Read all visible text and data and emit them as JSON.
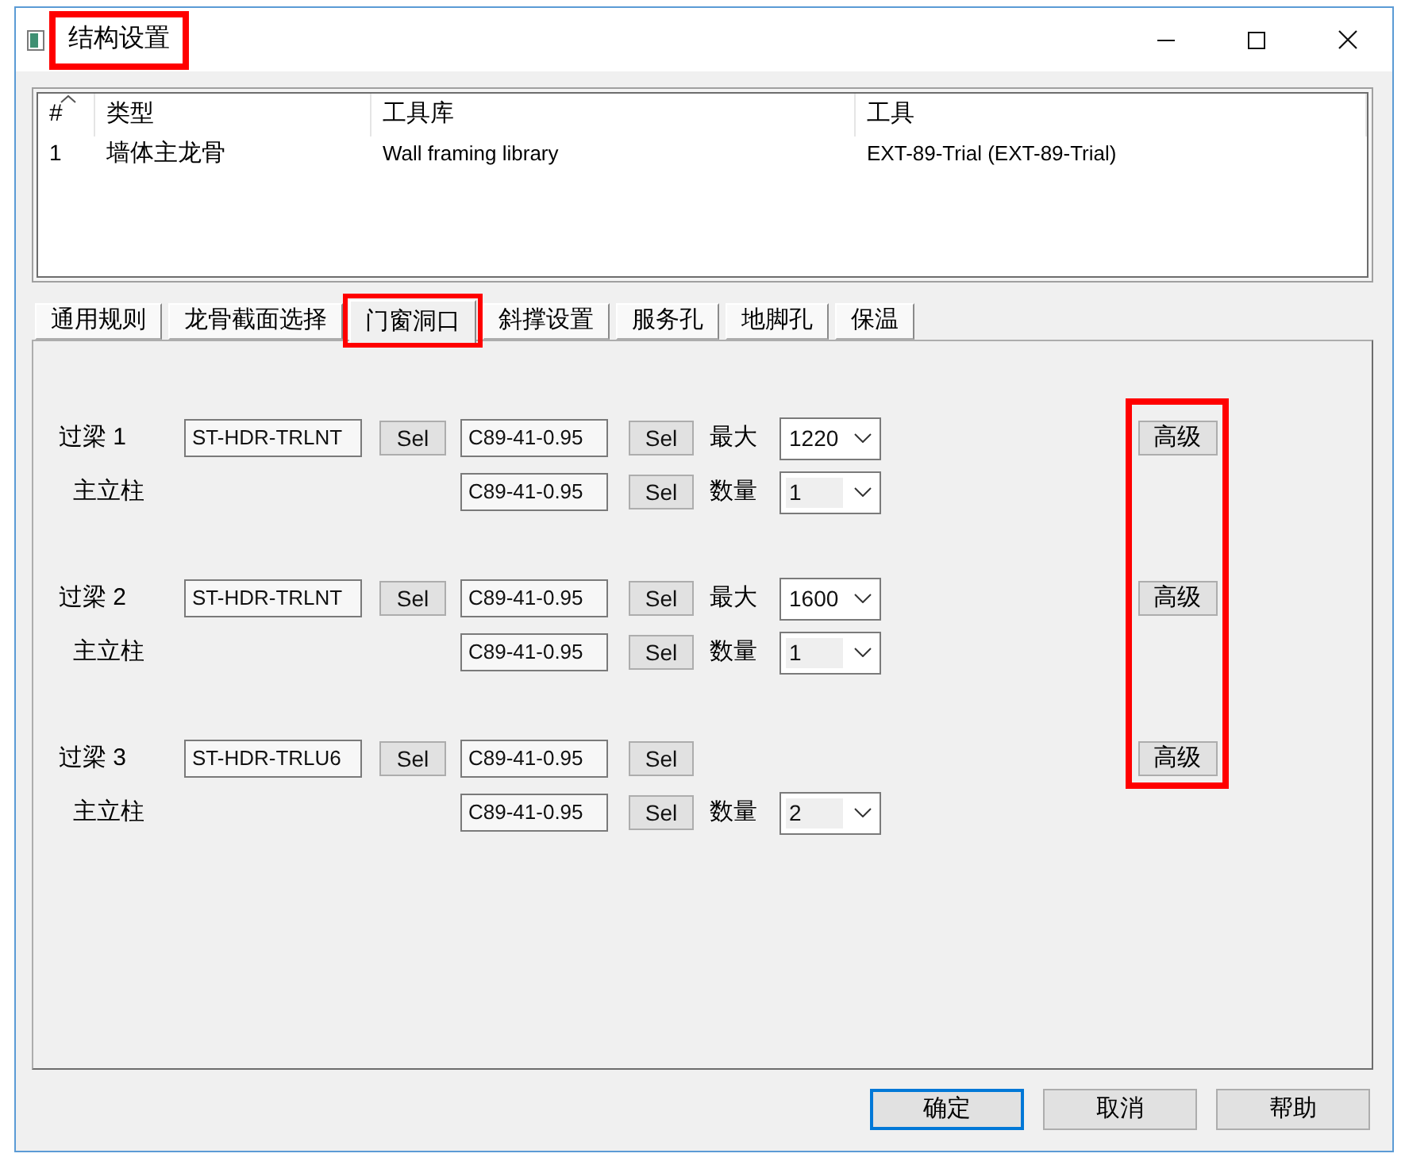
{
  "window": {
    "title": "结构设置",
    "title_highlighted": true
  },
  "list": {
    "columns": [
      "#",
      "类型",
      "工具库",
      "工具"
    ],
    "rows": [
      [
        "1",
        "墙体主龙骨",
        "Wall framing library",
        "EXT-89-Trial (EXT-89-Trial)"
      ]
    ]
  },
  "tabs": [
    {
      "label": "通用规则",
      "selected": false,
      "highlighted": false
    },
    {
      "label": "龙骨截面选择",
      "selected": false,
      "highlighted": false
    },
    {
      "label": "门窗洞口",
      "selected": true,
      "highlighted": true
    },
    {
      "label": "斜撑设置",
      "selected": false,
      "highlighted": false
    },
    {
      "label": "服务孔",
      "selected": false,
      "highlighted": false
    },
    {
      "label": "地脚孔",
      "selected": false,
      "highlighted": false
    },
    {
      "label": "保温",
      "selected": false,
      "highlighted": false
    }
  ],
  "panel": {
    "advanced_highlighted": true,
    "groups": [
      {
        "header": {
          "label": "过梁 1",
          "section": "ST-HDR-TRLNT",
          "section_button": "Sel",
          "stud": "C89-41-0.95",
          "stud_button": "Sel",
          "limit_label": "最大",
          "limit_value": "1220"
        },
        "stud_row": {
          "label": "主立柱",
          "stud": "C89-41-0.95",
          "stud_button": "Sel",
          "count_label": "数量",
          "count_value": "1"
        },
        "advanced_button": "高级"
      },
      {
        "header": {
          "label": "过梁 2",
          "section": "ST-HDR-TRLNT",
          "section_button": "Sel",
          "stud": "C89-41-0.95",
          "stud_button": "Sel",
          "limit_label": "最大",
          "limit_value": "1600"
        },
        "stud_row": {
          "label": "主立柱",
          "stud": "C89-41-0.95",
          "stud_button": "Sel",
          "count_label": "数量",
          "count_value": "1"
        },
        "advanced_button": "高级"
      },
      {
        "header": {
          "label": "过梁 3",
          "section": "ST-HDR-TRLU6",
          "section_button": "Sel",
          "stud": "C89-41-0.95",
          "stud_button": "Sel"
        },
        "stud_row": {
          "label": "主立柱",
          "stud": "C89-41-0.95",
          "stud_button": "Sel",
          "count_label": "数量",
          "count_value": "2"
        },
        "advanced_button": "高级"
      }
    ]
  },
  "buttons": [
    {
      "label": "确定",
      "default": true
    },
    {
      "label": "取消",
      "default": false
    },
    {
      "label": "帮助",
      "default": false
    }
  ]
}
